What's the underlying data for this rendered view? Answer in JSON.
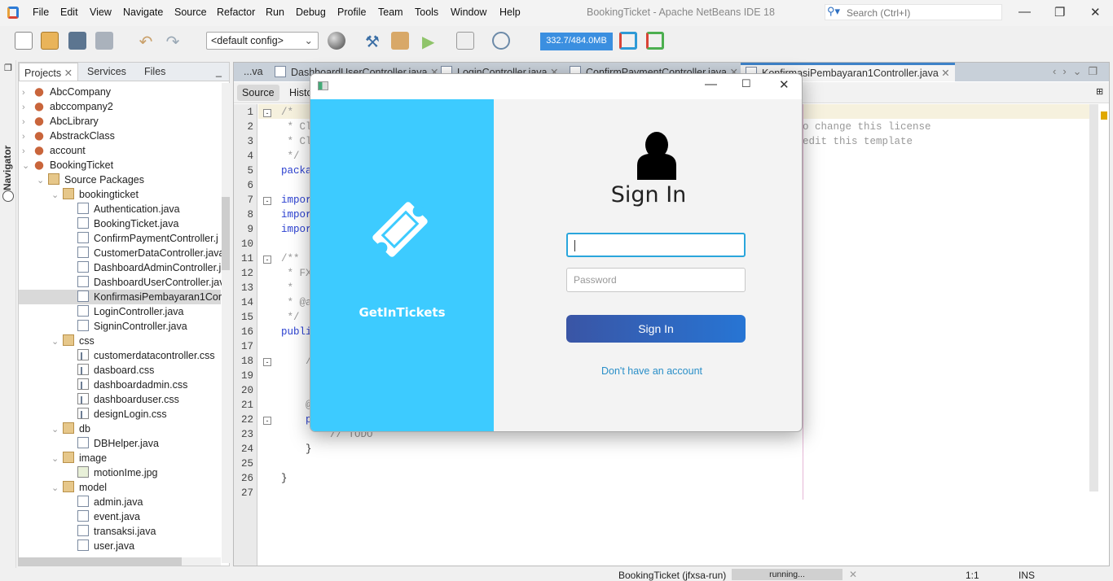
{
  "app": {
    "title": "BookingTicket - Apache NetBeans IDE 18",
    "search_placeholder": "Search (Ctrl+I)"
  },
  "menu": [
    "File",
    "Edit",
    "View",
    "Navigate",
    "Source",
    "Refactor",
    "Run",
    "Debug",
    "Profile",
    "Team",
    "Tools",
    "Window",
    "Help"
  ],
  "toolbar": {
    "config": "<default config>",
    "memory": "332.7/484.0MB"
  },
  "left": {
    "navigator": "Navigator",
    "tabs": [
      "Projects",
      "Services",
      "Files"
    ],
    "tree": [
      {
        "label": "AbcCompany",
        "level": 0,
        "icon": "cup",
        "chev": "›"
      },
      {
        "label": "abccompany2",
        "level": 0,
        "icon": "cup",
        "chev": "›"
      },
      {
        "label": "AbcLibrary",
        "level": 0,
        "icon": "cup",
        "chev": "›"
      },
      {
        "label": "AbstrackClass",
        "level": 0,
        "icon": "cup",
        "chev": "›"
      },
      {
        "label": "account",
        "level": 0,
        "icon": "cup",
        "chev": "›"
      },
      {
        "label": "BookingTicket",
        "level": 0,
        "icon": "cup",
        "chev": "⌄"
      },
      {
        "label": "Source Packages",
        "level": 1,
        "icon": "pkg",
        "chev": "⌄"
      },
      {
        "label": "bookingticket",
        "level": 2,
        "icon": "pkg",
        "chev": "⌄"
      },
      {
        "label": "Authentication.java",
        "level": 3,
        "icon": "jf"
      },
      {
        "label": "BookingTicket.java",
        "level": 3,
        "icon": "jf"
      },
      {
        "label": "ConfirmPaymentController.j",
        "level": 3,
        "icon": "jf"
      },
      {
        "label": "CustomerDataController.java",
        "level": 3,
        "icon": "jf"
      },
      {
        "label": "DashboardAdminController.j",
        "level": 3,
        "icon": "jf"
      },
      {
        "label": "DashboardUserController.jav",
        "level": 3,
        "icon": "jf"
      },
      {
        "label": "KonfirmasiPembayaran1Con",
        "level": 3,
        "icon": "jf",
        "selected": true
      },
      {
        "label": "LoginController.java",
        "level": 3,
        "icon": "jf"
      },
      {
        "label": "SigninController.java",
        "level": 3,
        "icon": "jf"
      },
      {
        "label": "css",
        "level": 2,
        "icon": "pkg",
        "chev": "⌄"
      },
      {
        "label": "customerdatacontroller.css",
        "level": 3,
        "icon": "cssf"
      },
      {
        "label": "dasboard.css",
        "level": 3,
        "icon": "cssf"
      },
      {
        "label": "dashboardadmin.css",
        "level": 3,
        "icon": "cssf"
      },
      {
        "label": "dashboarduser.css",
        "level": 3,
        "icon": "cssf"
      },
      {
        "label": "designLogin.css",
        "level": 3,
        "icon": "cssf"
      },
      {
        "label": "db",
        "level": 2,
        "icon": "pkg",
        "chev": "⌄"
      },
      {
        "label": "DBHelper.java",
        "level": 3,
        "icon": "jf"
      },
      {
        "label": "image",
        "level": 2,
        "icon": "pkg",
        "chev": "⌄"
      },
      {
        "label": "motionIme.jpg",
        "level": 3,
        "icon": "img"
      },
      {
        "label": "model",
        "level": 2,
        "icon": "pkg",
        "chev": "⌄"
      },
      {
        "label": "admin.java",
        "level": 3,
        "icon": "jf"
      },
      {
        "label": "event.java",
        "level": 3,
        "icon": "jf"
      },
      {
        "label": "transaksi.java",
        "level": 3,
        "icon": "jf"
      },
      {
        "label": "user.java",
        "level": 3,
        "icon": "jf"
      }
    ]
  },
  "editor": {
    "tabs": [
      "...va",
      "DashboardUserController.java",
      "LoginController.java",
      "ConfirmPaymentController.java",
      "KonfirmasiPembayaran1Controller.java"
    ],
    "source_tab": "Source",
    "history_tab": "Histo",
    "lines": [
      {
        "n": "1",
        "t": "/*",
        "c": ""
      },
      {
        "n": "2",
        "t": " * Cl",
        "c": ""
      },
      {
        "n": "3",
        "t": " * Cl",
        "c": ""
      },
      {
        "n": "4",
        "t": " */",
        "c": ""
      },
      {
        "n": "5",
        "t": "packa",
        "c": "kw"
      },
      {
        "n": "6",
        "t": "",
        "c": ""
      },
      {
        "n": "7",
        "t": "impor",
        "c": "kw"
      },
      {
        "n": "8",
        "t": "impor",
        "c": "kw"
      },
      {
        "n": "9",
        "t": "impor",
        "c": "kw"
      },
      {
        "n": "10",
        "t": "",
        "c": ""
      },
      {
        "n": "11",
        "t": "/**",
        "c": ""
      },
      {
        "n": "12",
        "t": " * FX",
        "c": ""
      },
      {
        "n": "13",
        "t": " *",
        "c": ""
      },
      {
        "n": "14",
        "t": " * @a",
        "c": ""
      },
      {
        "n": "15",
        "t": " */",
        "c": ""
      },
      {
        "n": "16",
        "t": "publi",
        "c": "kw"
      },
      {
        "n": "17",
        "t": "",
        "c": ""
      },
      {
        "n": "18",
        "t": "    /",
        "c": ""
      },
      {
        "n": "19",
        "t": "",
        "c": ""
      },
      {
        "n": "20",
        "t": "",
        "c": ""
      },
      {
        "n": "21",
        "t": "    @",
        "c": ""
      },
      {
        "n": "22",
        "t": "    p",
        "c": "kw"
      },
      {
        "n": "23",
        "t": "        // TODO",
        "c": ""
      },
      {
        "n": "24",
        "t": "    }",
        "c": "dk"
      },
      {
        "n": "25",
        "t": "",
        "c": ""
      },
      {
        "n": "26",
        "t": "}",
        "c": "dk"
      },
      {
        "n": "27",
        "t": "",
        "c": ""
      }
    ],
    "right_fragments": [
      "o change this license",
      "edit this template"
    ]
  },
  "dialog": {
    "brand": "GetInTickets",
    "title": "Sign In",
    "username_value": "",
    "password_placeholder": "Password",
    "signin_button": "Sign In",
    "register_link": "Don't have an account"
  },
  "status": {
    "project": "BookingTicket (jfxsa-run)",
    "progress": "running...",
    "position": "1:1",
    "mode": "INS"
  }
}
